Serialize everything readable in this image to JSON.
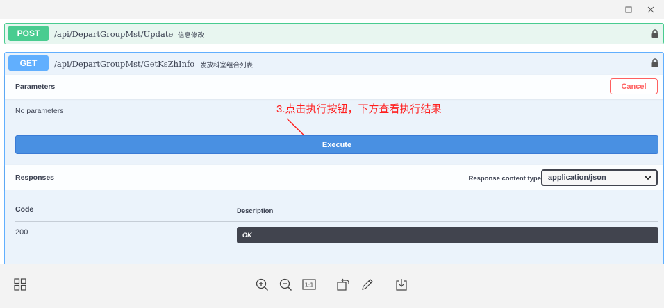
{
  "window": {
    "controls": {
      "minimize": "—",
      "maximize": "☐",
      "close": "✕"
    }
  },
  "post_op": {
    "method": "POST",
    "path": "/api/DepartGroupMst/Update",
    "description": "信息修改",
    "color": "#49cc90"
  },
  "get_op": {
    "method": "GET",
    "path": "/api/DepartGroupMst/GetKsZhInfo",
    "description": "发放科室组合列表",
    "color": "#61affe",
    "parameters": {
      "title": "Parameters",
      "cancel_label": "Cancel",
      "empty_text": "No parameters"
    },
    "annotation": "3.点击执行按钮，下方查看执行结果",
    "execute_label": "Execute",
    "responses": {
      "title": "Responses",
      "content_type_label": "Response content type",
      "content_type_value": "application/json",
      "columns": {
        "code": "Code",
        "description": "Description"
      },
      "rows": [
        {
          "code": "200",
          "description": "OK"
        }
      ]
    }
  },
  "toolbar": {
    "icons": [
      "grid-view-icon",
      "zoom-in-icon",
      "zoom-out-icon",
      "actual-size-icon",
      "rotate-icon",
      "edit-icon",
      "save-icon"
    ],
    "actual_size_label": "1:1"
  }
}
